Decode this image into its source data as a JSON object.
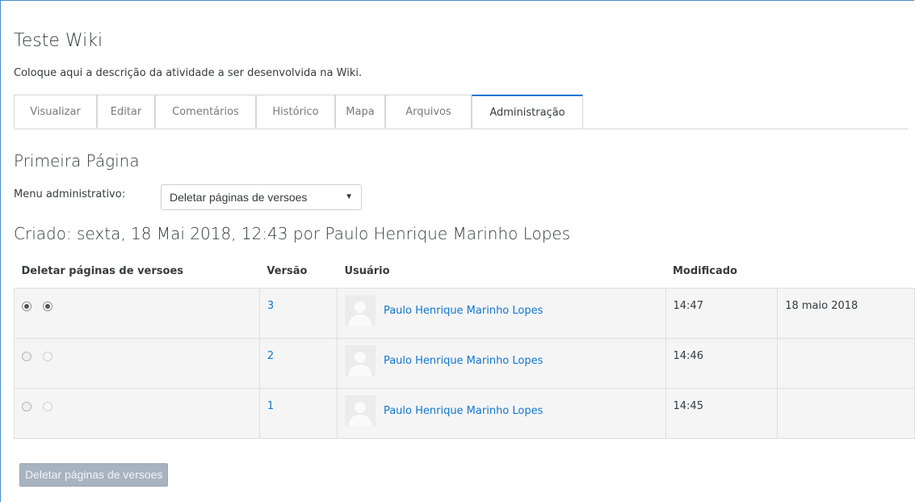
{
  "page": {
    "title": "Teste Wiki",
    "description": "Coloque aqui a descrição da atividade a ser desenvolvida na Wiki.",
    "tabs": [
      {
        "label": "Visualizar",
        "active": false
      },
      {
        "label": "Editar",
        "active": false
      },
      {
        "label": "Comentários",
        "active": false
      },
      {
        "label": "Histórico",
        "active": false
      },
      {
        "label": "Mapa",
        "active": false
      },
      {
        "label": "Arquivos",
        "active": false
      },
      {
        "label": "Administração",
        "active": true
      }
    ],
    "subtitle": "Primeira Página",
    "menu_label": "Menu administrativo:",
    "menu_selected": "Deletar páginas de versoes",
    "created": "Criado: sexta, 18 Mai 2018, 12:43 por Paulo Henrique Marinho Lopes"
  },
  "table": {
    "headers": [
      "Deletar páginas de versoes",
      "Versão",
      "Usuário",
      "Modificado",
      ""
    ],
    "rows": [
      {
        "version": "3",
        "user": "Paulo Henrique Marinho Lopes",
        "time": "14:47",
        "date": "18 maio 2018",
        "radio_from": true,
        "radio_to": true
      },
      {
        "version": "2",
        "user": "Paulo Henrique Marinho Lopes",
        "time": "14:46",
        "date": "",
        "radio_from": false,
        "radio_to": false
      },
      {
        "version": "1",
        "user": "Paulo Henrique Marinho Lopes",
        "time": "14:45",
        "date": "",
        "radio_from": false,
        "radio_to": false
      }
    ]
  },
  "actions": {
    "delete_button": "Deletar páginas de versoes"
  },
  "colors": {
    "link": "#1177d1",
    "active_tab_border": "#1177d1",
    "button_bg": "#a8b3c0"
  }
}
